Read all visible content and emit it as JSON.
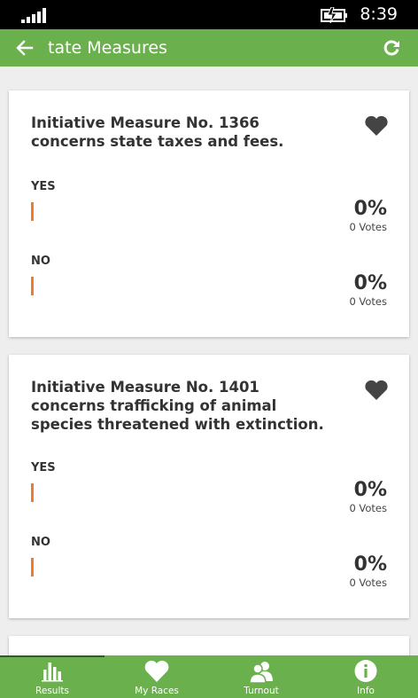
{
  "status_bar": {
    "time": "8:39",
    "signal_icon": "signal-bars-icon",
    "battery_icon": "battery-charging-icon"
  },
  "app_bar": {
    "title": "tate Measures",
    "back_icon": "arrow-left-icon",
    "refresh_icon": "refresh-icon",
    "color": "#6ab04c"
  },
  "measures": [
    {
      "title": "Initiative Measure No. 1366 concerns state taxes and fees.",
      "favorite_icon": "heart-icon",
      "options": [
        {
          "label": "YES",
          "percent": "0%",
          "votes": "0 Votes",
          "share": 0
        },
        {
          "label": "NO",
          "percent": "0%",
          "votes": "0 Votes",
          "share": 0
        }
      ]
    },
    {
      "title": "Initiative Measure No. 1401 concerns trafficking of animal species threatened with extinction.",
      "favorite_icon": "heart-icon",
      "options": [
        {
          "label": "YES",
          "percent": "0%",
          "votes": "0 Votes",
          "share": 0
        },
        {
          "label": "NO",
          "percent": "0%",
          "votes": "0 Votes",
          "share": 0
        }
      ]
    }
  ],
  "bottom_nav": {
    "active": "Results",
    "items": [
      {
        "label": "Results",
        "icon": "bar-chart-icon"
      },
      {
        "label": "My Races",
        "icon": "heart-icon"
      },
      {
        "label": "Turnout",
        "icon": "people-icon"
      },
      {
        "label": "Info",
        "icon": "info-icon"
      }
    ]
  },
  "colors": {
    "accent": "#6ab04c",
    "bar": "#f07b2d",
    "text": "#333333"
  }
}
